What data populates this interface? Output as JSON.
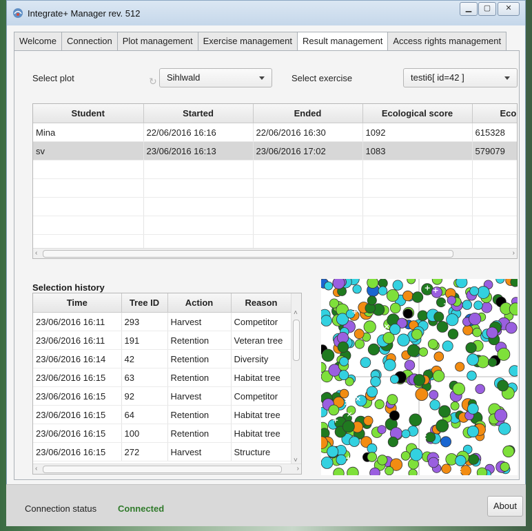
{
  "window": {
    "title": "Integrate+ Manager rev. 512"
  },
  "tabs": [
    {
      "label": "Welcome"
    },
    {
      "label": "Connection"
    },
    {
      "label": "Plot management"
    },
    {
      "label": "Exercise management"
    },
    {
      "label": "Result management",
      "active": true
    },
    {
      "label": "Access rights management"
    }
  ],
  "controls": {
    "select_plot_label": "Select plot",
    "plot_value": "Sihlwald",
    "select_exercise_label": "Select exercise",
    "exercise_value": "testi6[ id=42 ]"
  },
  "results": {
    "columns": [
      "Student",
      "Started",
      "Ended",
      "Ecological score",
      "Econc"
    ],
    "rows": [
      [
        "Mina",
        "22/06/2016 16:16",
        "22/06/2016 16:30",
        "1092",
        "615328"
      ],
      [
        "sv",
        "23/06/2016 16:13",
        "23/06/2016 17:02",
        "1083",
        "579079"
      ]
    ],
    "selected_row": 1
  },
  "history": {
    "title": "Selection history",
    "columns": [
      "Time",
      "Tree ID",
      "Action",
      "Reason"
    ],
    "rows": [
      [
        "23/06/2016 16:11",
        "293",
        "Harvest",
        "Competitor"
      ],
      [
        "23/06/2016 16:11",
        "191",
        "Retention",
        "Veteran tree"
      ],
      [
        "23/06/2016 16:14",
        "42",
        "Retention",
        "Diversity"
      ],
      [
        "23/06/2016 16:15",
        "63",
        "Retention",
        "Habitat tree"
      ],
      [
        "23/06/2016 16:15",
        "92",
        "Harvest",
        "Competitor"
      ],
      [
        "23/06/2016 16:15",
        "64",
        "Retention",
        "Habitat tree"
      ],
      [
        "23/06/2016 16:15",
        "100",
        "Retention",
        "Habitat tree"
      ],
      [
        "23/06/2016 16:15",
        "272",
        "Harvest",
        "Structure"
      ]
    ]
  },
  "tree_map": {
    "colors": [
      "#33d1e0",
      "#7ee03a",
      "#1f7a1f",
      "#9a5fe0",
      "#f28c12",
      "#000000",
      "#1a66d1"
    ],
    "icons": [
      "plus-marker-icon",
      "cross-marker-icon"
    ]
  },
  "footer": {
    "status_label": "Connection status",
    "status_value": "Connected",
    "status_color": "#2f7a2a",
    "about_label": "About"
  }
}
